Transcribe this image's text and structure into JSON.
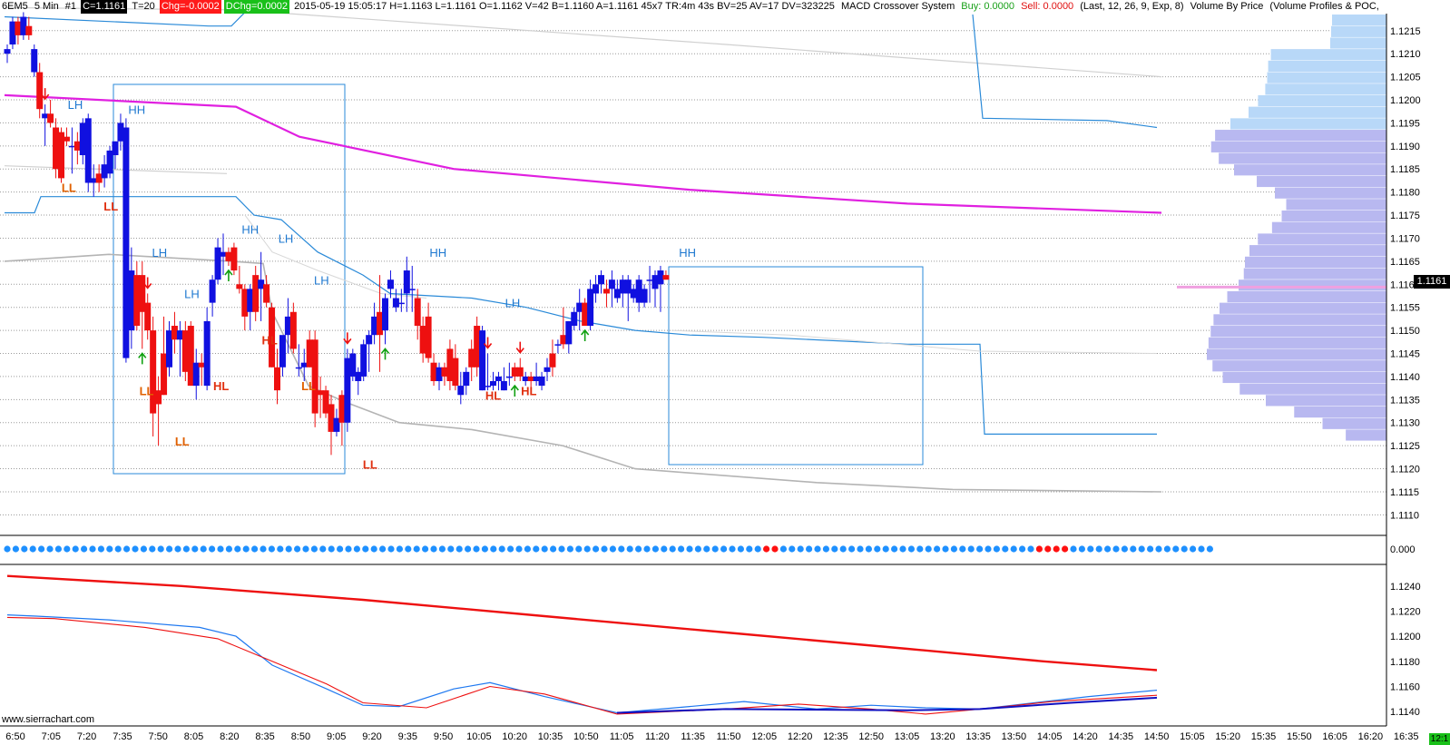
{
  "header": {
    "symbol": "6EM5",
    "interval": "5 Min",
    "chart_no": "#1",
    "close": "C=1.1161",
    "trades": "T=20",
    "chg": "Chg=-0.0002",
    "dchg": "DChg=0.0002",
    "stats": "2015-05-19 15:05:17 H=1.1163 L=1.1161 O=1.1162 V=42 B=1.1160 A=1.1161 45x7 TR:4m 43s BV=25 AV=17 DV=323225",
    "study": "MACD Crossover System",
    "buy": "Buy: 0.0000",
    "sell": "Sell: 0.0000",
    "params": "(Last, 12, 26, 9, Exp, 8)",
    "vbp": "Volume By Price",
    "vbp_params": "(Volume Profiles & POC,"
  },
  "watermark": "www.sierrachart.com",
  "last_price_label": "1.1161",
  "corner_label": "12:1",
  "colors": {
    "up": "#1010e0",
    "down": "#ee1010",
    "magenta": "#e020e0",
    "band": "#2a8ad8",
    "gray": "#b4b4b4",
    "grid": "#cfcfcf",
    "vbp": "#b8b8f0",
    "vbp_top": "#b8d8f8",
    "poc": "#f0a0e0",
    "dot_blue": "#1e90ff",
    "dot_red": "#ff1010",
    "label_blue": "#1e78d0",
    "label_red": "#e03010",
    "label_orange": "#e06000"
  },
  "chart_data": [
    {
      "type": "candlestick",
      "title": "6EM5 5 Min",
      "price_ticks": [
        "1.1215",
        "1.1210",
        "1.1205",
        "1.1200",
        "1.1195",
        "1.1190",
        "1.1185",
        "1.1180",
        "1.1175",
        "1.1170",
        "1.1165",
        "1.1160",
        "1.1155",
        "1.1150",
        "1.1145",
        "1.1140",
        "1.1135",
        "1.1130",
        "1.1125",
        "1.1120",
        "1.1115",
        "1.1110"
      ],
      "time_ticks": [
        "6:50",
        "7:05",
        "7:20",
        "7:35",
        "7:50",
        "8:05",
        "8:20",
        "8:35",
        "8:50",
        "9:05",
        "9:20",
        "9:35",
        "9:50",
        "10:05",
        "10:20",
        "10:35",
        "10:50",
        "11:05",
        "11:20",
        "11:35",
        "11:50",
        "12:05",
        "12:20",
        "12:35",
        "12:50",
        "13:05",
        "13:20",
        "13:35",
        "13:50",
        "14:05",
        "14:20",
        "14:35",
        "14:50",
        "15:05",
        "15:20",
        "15:35",
        "15:50",
        "16:05",
        "16:20",
        "16:35"
      ],
      "ylim": [
        1.11085,
        1.12185
      ],
      "bars_ohlc": [
        [
          1.121,
          1.1212,
          1.1208,
          1.1211
        ],
        [
          1.1212,
          1.1218,
          1.1211,
          1.1217
        ],
        [
          1.1217,
          1.1218,
          1.1212,
          1.1214
        ],
        [
          1.1214,
          1.1219,
          1.1213,
          1.1218
        ],
        [
          1.1216,
          1.1218,
          1.1213,
          1.1214
        ],
        [
          1.1206,
          1.1212,
          1.1205,
          1.1211
        ],
        [
          1.1206,
          1.1208,
          1.1196,
          1.1198
        ],
        [
          1.1196,
          1.1199,
          1.119,
          1.1197
        ],
        [
          1.1197,
          1.12,
          1.1194,
          1.1195
        ],
        [
          1.1194,
          1.1196,
          1.1183,
          1.1185
        ],
        [
          1.1193,
          1.1194,
          1.1182,
          1.1183
        ],
        [
          1.1192,
          1.1194,
          1.119,
          1.1191
        ],
        [
          1.119,
          1.1194,
          1.1184,
          1.119
        ],
        [
          1.1191,
          1.1193,
          1.1186,
          1.1189
        ],
        [
          1.1188,
          1.1196,
          1.1186,
          1.1195
        ],
        [
          1.1182,
          1.1197,
          1.118,
          1.1196
        ],
        [
          1.1182,
          1.1186,
          1.1179,
          1.1183
        ],
        [
          1.1184,
          1.1186,
          1.118,
          1.1182
        ],
        [
          1.1183,
          1.1188,
          1.1181,
          1.1186
        ],
        [
          1.1184,
          1.119,
          1.1183,
          1.1189
        ],
        [
          1.1188,
          1.1191,
          1.1185,
          1.1191
        ],
        [
          1.1191,
          1.1197,
          1.1189,
          1.1195
        ],
        [
          1.1144,
          1.1196,
          1.1143,
          1.1194
        ],
        [
          1.115,
          1.1168,
          1.1146,
          1.1163
        ],
        [
          1.1162,
          1.1165,
          1.115,
          1.1151
        ],
        [
          1.1162,
          1.1165,
          1.1146,
          1.1154
        ],
        [
          1.1156,
          1.1158,
          1.1148,
          1.115
        ],
        [
          1.115,
          1.1153,
          1.1127,
          1.1132
        ],
        [
          1.1137,
          1.114,
          1.1125,
          1.1134
        ],
        [
          1.1145,
          1.1153,
          1.1136,
          1.1136
        ],
        [
          1.1142,
          1.1152,
          1.114,
          1.115
        ],
        [
          1.1151,
          1.1154,
          1.1145,
          1.1148
        ],
        [
          1.1148,
          1.1152,
          1.114,
          1.115
        ],
        [
          1.115,
          1.1152,
          1.1139,
          1.1141
        ],
        [
          1.1151,
          1.1152,
          1.1138,
          1.1138
        ],
        [
          1.1138,
          1.1146,
          1.1135,
          1.1143
        ],
        [
          1.1143,
          1.1145,
          1.1138,
          1.1142
        ],
        [
          1.1138,
          1.1155,
          1.1137,
          1.1152
        ],
        [
          1.1156,
          1.1162,
          1.1153,
          1.1161
        ],
        [
          1.1161,
          1.117,
          1.116,
          1.1168
        ],
        [
          1.1166,
          1.1171,
          1.1162,
          1.1167
        ],
        [
          1.1167,
          1.1168,
          1.1164,
          1.1165
        ],
        [
          1.1168,
          1.1169,
          1.1162,
          1.1163
        ],
        [
          1.116,
          1.1164,
          1.1158,
          1.1159
        ],
        [
          1.1159,
          1.116,
          1.115,
          1.1153
        ],
        [
          1.1154,
          1.116,
          1.115,
          1.1159
        ],
        [
          1.1162,
          1.1164,
          1.1152,
          1.1154
        ],
        [
          1.1159,
          1.1167,
          1.1152,
          1.1161
        ],
        [
          1.116,
          1.1162,
          1.1155,
          1.1156
        ],
        [
          1.1155,
          1.1156,
          1.1142,
          1.1142
        ],
        [
          1.1142,
          1.1146,
          1.1134,
          1.1137
        ],
        [
          1.1142,
          1.1148,
          1.114,
          1.1149
        ],
        [
          1.1149,
          1.1157,
          1.1145,
          1.1153
        ],
        [
          1.1154,
          1.1156,
          1.1145,
          1.1146
        ],
        [
          1.1142,
          1.1147,
          1.114,
          1.1142
        ],
        [
          1.1142,
          1.1146,
          1.1139,
          1.1143
        ],
        [
          1.1148,
          1.115,
          1.1142,
          1.1142
        ],
        [
          1.1148,
          1.115,
          1.1129,
          1.1132
        ],
        [
          1.1137,
          1.114,
          1.1131,
          1.1136
        ],
        [
          1.1137,
          1.1138,
          1.1131,
          1.1132
        ],
        [
          1.1134,
          1.1136,
          1.1123,
          1.1128
        ],
        [
          1.1128,
          1.1133,
          1.1127,
          1.1131
        ],
        [
          1.1136,
          1.1137,
          1.1125,
          1.113
        ],
        [
          1.113,
          1.1146,
          1.1128,
          1.1144
        ],
        [
          1.114,
          1.1146,
          1.1139,
          1.1145
        ],
        [
          1.1139,
          1.1142,
          1.1136,
          1.1141
        ],
        [
          1.114,
          1.1148,
          1.1139,
          1.1147
        ],
        [
          1.1147,
          1.115,
          1.1141,
          1.1149
        ],
        [
          1.1149,
          1.1156,
          1.1147,
          1.1153
        ],
        [
          1.1154,
          1.1162,
          1.1141,
          1.1149
        ],
        [
          1.115,
          1.1158,
          1.1147,
          1.1157
        ],
        [
          1.1159,
          1.1163,
          1.1157,
          1.1161
        ],
        [
          1.1155,
          1.1159,
          1.1154,
          1.1157
        ],
        [
          1.1156,
          1.1159,
          1.1154,
          1.1156
        ],
        [
          1.1158,
          1.1166,
          1.1154,
          1.1163
        ],
        [
          1.1159,
          1.1164,
          1.1154,
          1.1159
        ],
        [
          1.1157,
          1.1159,
          1.1148,
          1.1151
        ],
        [
          1.1151,
          1.1153,
          1.1143,
          1.1145
        ],
        [
          1.1153,
          1.1156,
          1.1143,
          1.1144
        ],
        [
          1.1143,
          1.1145,
          1.1138,
          1.1139
        ],
        [
          1.1139,
          1.1143,
          1.1137,
          1.1142
        ],
        [
          1.1142,
          1.1143,
          1.1138,
          1.114
        ],
        [
          1.1146,
          1.1148,
          1.1137,
          1.1139
        ],
        [
          1.1144,
          1.1147,
          1.1137,
          1.1138
        ],
        [
          1.1136,
          1.1141,
          1.1134,
          1.1138
        ],
        [
          1.1138,
          1.1142,
          1.1136,
          1.1141
        ],
        [
          1.1146,
          1.1148,
          1.1139,
          1.1142
        ],
        [
          1.1151,
          1.1153,
          1.114,
          1.1142
        ],
        [
          1.1137,
          1.1151,
          1.1137,
          1.115
        ],
        [
          1.1138,
          1.1145,
          1.1137,
          1.1138
        ],
        [
          1.1138,
          1.1141,
          1.1137,
          1.1139
        ],
        [
          1.1139,
          1.1141,
          1.1137,
          1.114
        ],
        [
          1.1137,
          1.1142,
          1.1137,
          1.1139
        ],
        [
          1.114,
          1.1143,
          1.1138,
          1.114
        ],
        [
          1.1142,
          1.1143,
          1.1139,
          1.114
        ],
        [
          1.1142,
          1.1144,
          1.1139,
          1.114
        ],
        [
          1.1139,
          1.1141,
          1.1138,
          1.114
        ],
        [
          1.114,
          1.1141,
          1.1137,
          1.1139
        ],
        [
          1.1139,
          1.1143,
          1.1138,
          1.114
        ],
        [
          1.1138,
          1.1141,
          1.1137,
          1.114
        ],
        [
          1.1141,
          1.1144,
          1.1139,
          1.1142
        ],
        [
          1.1145,
          1.1148,
          1.114,
          1.1142
        ],
        [
          1.1147,
          1.1148,
          1.1145,
          1.1147
        ],
        [
          1.1149,
          1.1155,
          1.1146,
          1.1147
        ],
        [
          1.1147,
          1.1152,
          1.1145,
          1.1152
        ],
        [
          1.1151,
          1.1155,
          1.115,
          1.1154
        ],
        [
          1.1154,
          1.1159,
          1.115,
          1.1156
        ],
        [
          1.1156,
          1.1157,
          1.1151,
          1.1151
        ],
        [
          1.1151,
          1.1161,
          1.115,
          1.1159
        ],
        [
          1.1158,
          1.1162,
          1.1156,
          1.116
        ],
        [
          1.116,
          1.1163,
          1.1158,
          1.1162
        ],
        [
          1.1159,
          1.1161,
          1.1155,
          1.1158
        ],
        [
          1.1159,
          1.1163,
          1.1155,
          1.1161
        ],
        [
          1.1157,
          1.1161,
          1.1156,
          1.1159
        ],
        [
          1.1158,
          1.1162,
          1.1155,
          1.1161
        ],
        [
          1.1158,
          1.1162,
          1.1152,
          1.1161
        ],
        [
          1.1157,
          1.116,
          1.1156,
          1.1159
        ],
        [
          1.1156,
          1.1162,
          1.1154,
          1.1161
        ],
        [
          1.1156,
          1.116,
          1.1155,
          1.1159
        ],
        [
          1.1161,
          1.1164,
          1.1156,
          1.1161
        ],
        [
          1.1159,
          1.1163,
          1.1155,
          1.1162
        ],
        [
          1.116,
          1.1164,
          1.1154,
          1.1163
        ],
        [
          1.1162,
          1.1163,
          1.1161,
          1.1161
        ]
      ],
      "swing_labels": [
        {
          "text": "LH",
          "bar": 21,
          "price": 1.1198,
          "color": "blue"
        },
        {
          "text": "HH",
          "bar": 40,
          "price": 1.1197,
          "color": "blue"
        },
        {
          "text": "LL",
          "bar": 19,
          "price": 1.118,
          "color": "orange"
        },
        {
          "text": "LL",
          "bar": 32,
          "price": 1.1176,
          "color": "red"
        },
        {
          "text": "LH",
          "bar": 47,
          "price": 1.1166,
          "color": "blue"
        },
        {
          "text": "LL",
          "bar": 43,
          "price": 1.1136,
          "color": "orange"
        },
        {
          "text": "LH",
          "bar": 57,
          "price": 1.1157,
          "color": "blue"
        },
        {
          "text": "LL",
          "bar": 54,
          "price": 1.1125,
          "color": "orange"
        },
        {
          "text": "HL",
          "bar": 66,
          "price": 1.1137,
          "color": "red"
        },
        {
          "text": "HH",
          "bar": 75,
          "price": 1.1171,
          "color": "blue"
        },
        {
          "text": "LH",
          "bar": 86,
          "price": 1.1169,
          "color": "blue"
        },
        {
          "text": "HL",
          "bar": 81,
          "price": 1.1147,
          "color": "red"
        },
        {
          "text": "LL",
          "bar": 93,
          "price": 1.1137,
          "color": "orange"
        },
        {
          "text": "LH",
          "bar": 97,
          "price": 1.116,
          "color": "blue"
        },
        {
          "text": "LL",
          "bar": 112,
          "price": 1.112,
          "color": "red"
        },
        {
          "text": "HH",
          "bar": 133,
          "price": 1.1166,
          "color": "blue"
        },
        {
          "text": "HL",
          "bar": 150,
          "price": 1.1135,
          "color": "red"
        },
        {
          "text": "LH",
          "bar": 156,
          "price": 1.1155,
          "color": "blue"
        },
        {
          "text": "HL",
          "bar": 161,
          "price": 1.1136,
          "color": "red"
        },
        {
          "text": "HH",
          "bar": 210,
          "price": 1.1166,
          "color": "blue"
        }
      ],
      "arrows": [
        {
          "dir": "down",
          "bar": 12
        },
        {
          "dir": "down",
          "bar": 44
        },
        {
          "dir": "up",
          "bar": 42
        },
        {
          "dir": "up",
          "bar": 69
        },
        {
          "dir": "down",
          "bar": 105
        },
        {
          "dir": "up",
          "bar": 116
        },
        {
          "dir": "down",
          "bar": 148
        },
        {
          "dir": "up",
          "bar": 156
        },
        {
          "dir": "down",
          "bar": 158
        },
        {
          "dir": "up",
          "bar": 178
        }
      ]
    },
    {
      "type": "heatmap",
      "title": "MACD Crossover System",
      "zero_label": "0.000",
      "dots": "bbbbbbbbbbbbbbbbbbbbbbbbbbbbbbbbbbbbbbbbbbbbbbbbbbbbbbbbbbbbbbbbbbbbbbbbbbbbbbbbbbbbbbbbbrrbbbbbbbbbbbbbbbbbbbbbbbbbbbbbbrrrrbbbbbbbbbbbbbbbbb"
    },
    {
      "type": "line",
      "title": "MACD",
      "ticks": [
        "1.1240",
        "1.1220",
        "1.1200",
        "1.1180",
        "1.1160",
        "1.1140"
      ],
      "ylim": [
        1.113,
        1.1255
      ]
    }
  ]
}
